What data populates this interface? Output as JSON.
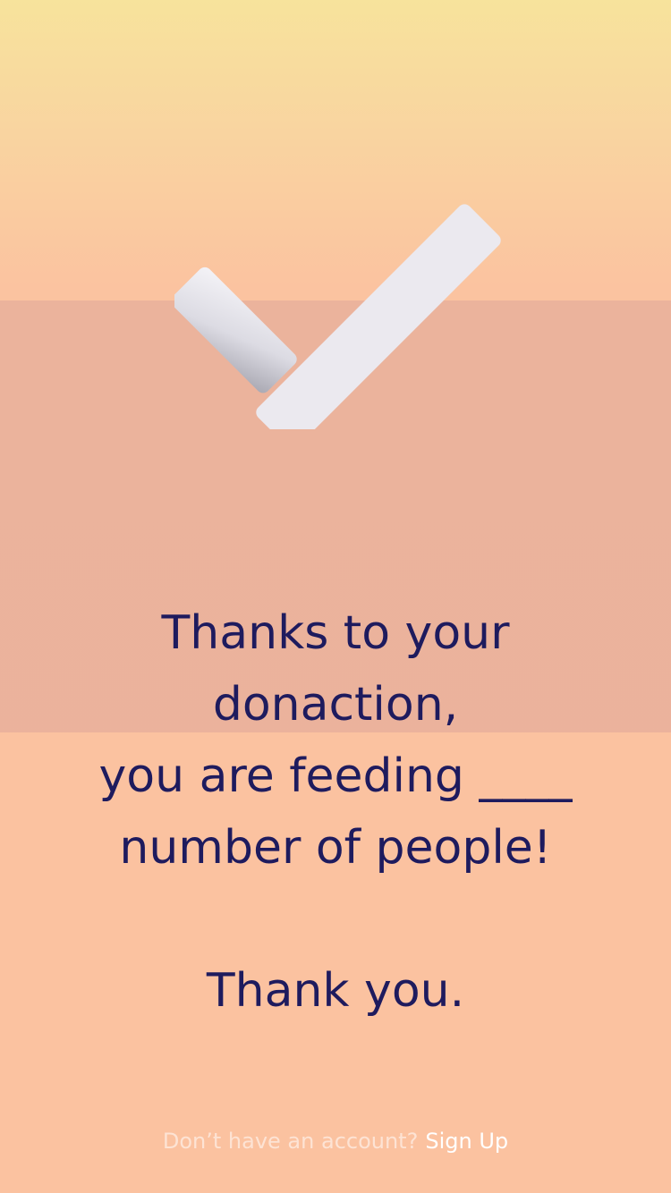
{
  "colors": {
    "gradient_top": "#f7e39c",
    "gradient_bottom": "#fbc2a0",
    "overlay_band": "#e8b39e",
    "message_text": "#1e1b5e",
    "check_fill": "#ebe9ef",
    "footer_muted": "#fde4d6",
    "footer_link": "#ffffff"
  },
  "icon": {
    "name": "checkmark-icon"
  },
  "message": {
    "line1": "Thanks to your",
    "line2": "donaction,",
    "line3": "you are feeding ____",
    "line4": "number of people!",
    "thanks": "Thank you."
  },
  "footer": {
    "question": "Don’t have an account?",
    "signup_label": "Sign Up"
  }
}
